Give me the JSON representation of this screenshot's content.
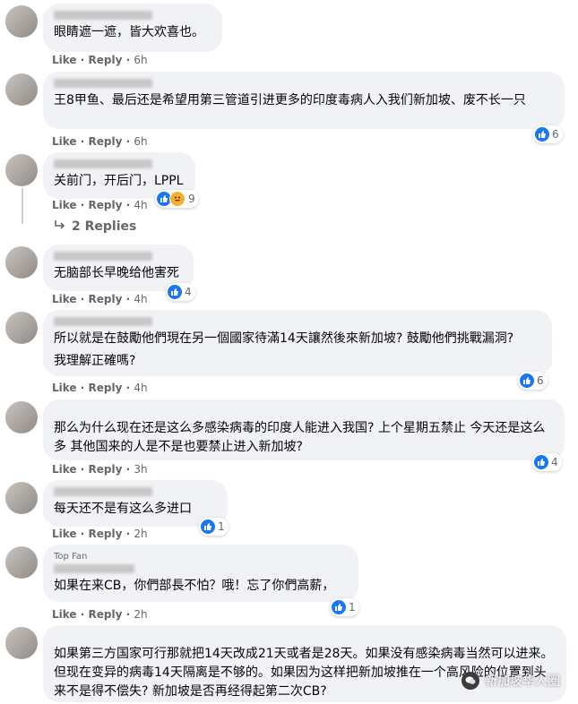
{
  "comments": [
    {
      "text": "眼睛遮一遮，皆大欢喜也。",
      "like": "Like",
      "reply": "Reply",
      "time": "6h"
    },
    {
      "text": "王8甲鱼、最后还是希望用第三管道引进更多的印度毒病人入我们新加坡、废不长一只",
      "like": "Like",
      "reply": "Reply",
      "time": "6h",
      "reactions": "6"
    },
    {
      "text": "关前门，开后门，LPPL",
      "like": "Like",
      "reply": "Reply",
      "time": "4h",
      "reactions": "9"
    },
    {
      "text": "无脑部长早晚给他害死",
      "like": "Like",
      "reply": "Reply",
      "time": "4h",
      "reactions": "4"
    },
    {
      "text": "所以就是在鼓勵他們現在另一個國家待滿14天讓然後來新加坡? 鼓勵他們挑戰漏洞?",
      "text2": "我理解正確嗎?",
      "like": "Like",
      "reply": "Reply",
      "time": "4h",
      "reactions": "6"
    },
    {
      "text": "那么为什么现在还是这么多感染病毒的印度人能进入我国? 上个星期五禁止 今天还是这么多 其他国来的人是不是也要禁止进入新加坡?",
      "like": "Like",
      "reply": "Reply",
      "time": "3h",
      "reactions": "4"
    },
    {
      "text": "每天还不是有这么多进口",
      "like": "Like",
      "reply": "Reply",
      "time": "2h",
      "reactions": "1"
    },
    {
      "badge": "Top Fan",
      "text": "如果在来CB，你們部長不怕？哦！忘了你們高薪，",
      "like": "Like",
      "reply": "Reply",
      "time": "2h",
      "reactions": "1"
    },
    {
      "text": "如果第三方国家可行那就把14天改成21天或者是28天。如果没有感染病毒当然可以进来。但现在变异的病毒14天隔离是不够的。如果因为这样把新加坡推在一个高风险的位置到头来不是得不偿失? 新加坡是否再经得起第二次CB?"
    }
  ],
  "replies_label": "2 Replies",
  "watermark": "新加坡华人圈",
  "colors": {
    "bubble": "#f0f2f5",
    "meta": "#65676b",
    "like_blue": "#1877f2"
  }
}
